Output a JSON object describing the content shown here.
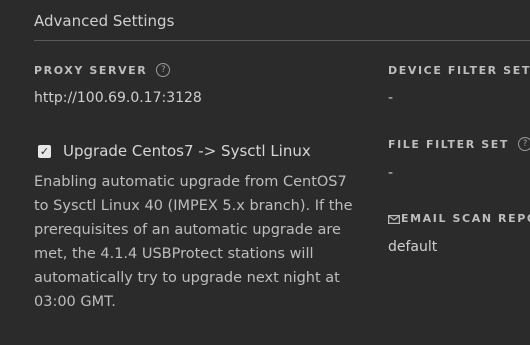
{
  "header": {
    "title": "Advanced Settings"
  },
  "proxy": {
    "label": "PROXY SERVER",
    "help_icon": "?",
    "value": "http://100.69.0.17:3128"
  },
  "upgrade": {
    "checked": true,
    "check_glyph": "✓",
    "label": "Upgrade Centos7 -> Sysctl Linux",
    "description": "Enabling automatic upgrade from CentOS7 to Sysctl Linux 40 (IMPEX 5.x branch). If the prerequisites of an automatic upgrade are met, the 4.1.4 USBProtect stations will automatically try to upgrade next night at 03:00 GMT."
  },
  "device_filter": {
    "label": "DEVICE FILTER SET",
    "help_icon": "?",
    "value": "-"
  },
  "file_filter": {
    "label": "FILE FILTER SET",
    "help_icon": "?",
    "value": "-"
  },
  "email_scan": {
    "label": "EMAIL SCAN REPO",
    "icon": "envelope-icon",
    "value": "default"
  }
}
